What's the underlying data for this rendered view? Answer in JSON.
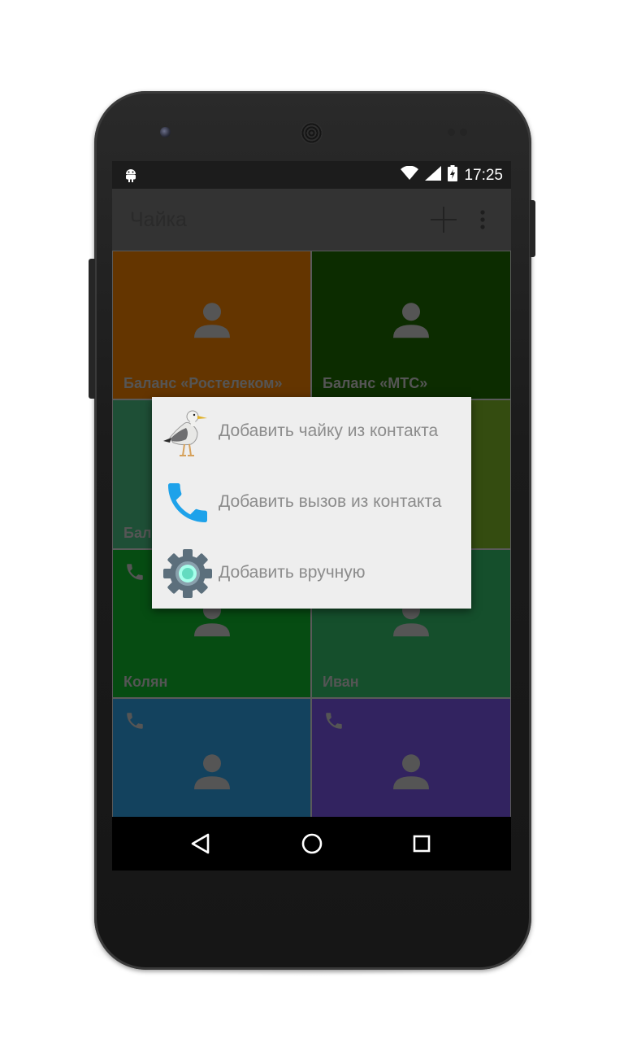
{
  "status_bar": {
    "time": "17:25",
    "icons": [
      "android-debug-icon",
      "wifi-icon",
      "signal-icon",
      "battery-charging-icon"
    ]
  },
  "action_bar": {
    "title": "Чайка",
    "actions": [
      "add-icon",
      "overflow-menu-icon"
    ]
  },
  "tiles": [
    {
      "label": "Баланс «Ростелеком»",
      "color": "#643500",
      "icon": "person-icon",
      "call_icon": false
    },
    {
      "label": "Баланс «МТС»",
      "color": "#0c2c00",
      "icon": "person-icon",
      "call_icon": false
    },
    {
      "label": "Бала",
      "color": "#1e4f36",
      "icon": "person-icon",
      "call_icon": false
    },
    {
      "label": "",
      "color": "#344c10",
      "icon": "person-icon",
      "call_icon": false
    },
    {
      "label": "Колян",
      "color": "#064c12",
      "icon": "person-icon",
      "call_icon": true
    },
    {
      "label": "Иван",
      "color": "#154f2c",
      "icon": "person-icon",
      "call_icon": true
    },
    {
      "label": "",
      "color": "#13425e",
      "icon": "person-icon",
      "call_icon": true
    },
    {
      "label": "",
      "color": "#322360",
      "icon": "person-icon",
      "call_icon": true
    }
  ],
  "dialog": {
    "items": [
      {
        "label": "Добавить чайку из контакта",
        "icon": "seagull-icon"
      },
      {
        "label": "Добавить вызов из контакта",
        "icon": "phone-icon"
      },
      {
        "label": "Добавить вручную",
        "icon": "gear-icon"
      }
    ]
  },
  "nav_bar": {
    "buttons": [
      "back-icon",
      "home-icon",
      "recents-icon"
    ]
  }
}
